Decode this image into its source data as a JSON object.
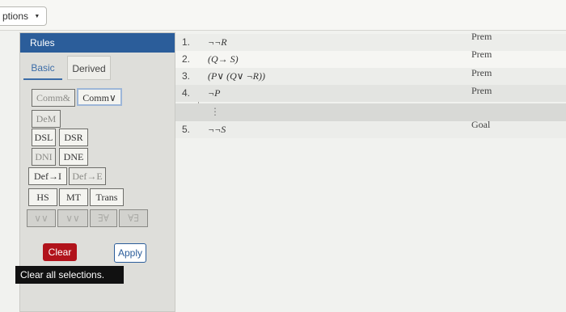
{
  "topbar": {
    "options_label": "ptions",
    "options_caret": "▼"
  },
  "left_panel": {
    "header": "Rules",
    "tabs": [
      {
        "label": "Basic",
        "active": true
      },
      {
        "label": "Derived",
        "active": false
      }
    ],
    "rules": {
      "comm_and": "Comm&",
      "comm_or": "Comm∨",
      "dem": "DeM",
      "dsl": "DSL",
      "dsr": "DSR",
      "dni": "DNI",
      "dne": "DNE",
      "def_i": "Def→I",
      "def_e": "Def→E",
      "hs": "HS",
      "mt": "MT",
      "trans": "Trans",
      "faded_1": "∨∨",
      "faded_2": "∨∨",
      "faded_3": "∃∀",
      "faded_4": "∀∃"
    },
    "clear_label": "Clear",
    "apply_label": "Apply",
    "tooltip": "Clear all selections."
  },
  "proof": {
    "lines": [
      {
        "num": "1.",
        "formula": "¬¬R",
        "just": "Prem"
      },
      {
        "num": "2.",
        "formula": "(Q→ S)",
        "just": "Prem"
      },
      {
        "num": "3.",
        "formula": "(P∨ (Q∨ ¬R))",
        "just": "Prem"
      },
      {
        "num": "4.",
        "formula": "¬P",
        "just": "Prem"
      },
      {
        "num": "",
        "formula": "⋮",
        "just": ""
      },
      {
        "num": "5.",
        "formula": "¬¬S",
        "just": "Goal"
      }
    ]
  },
  "colors": {
    "accent": "#2b5d9a",
    "danger": "#b1131b"
  }
}
